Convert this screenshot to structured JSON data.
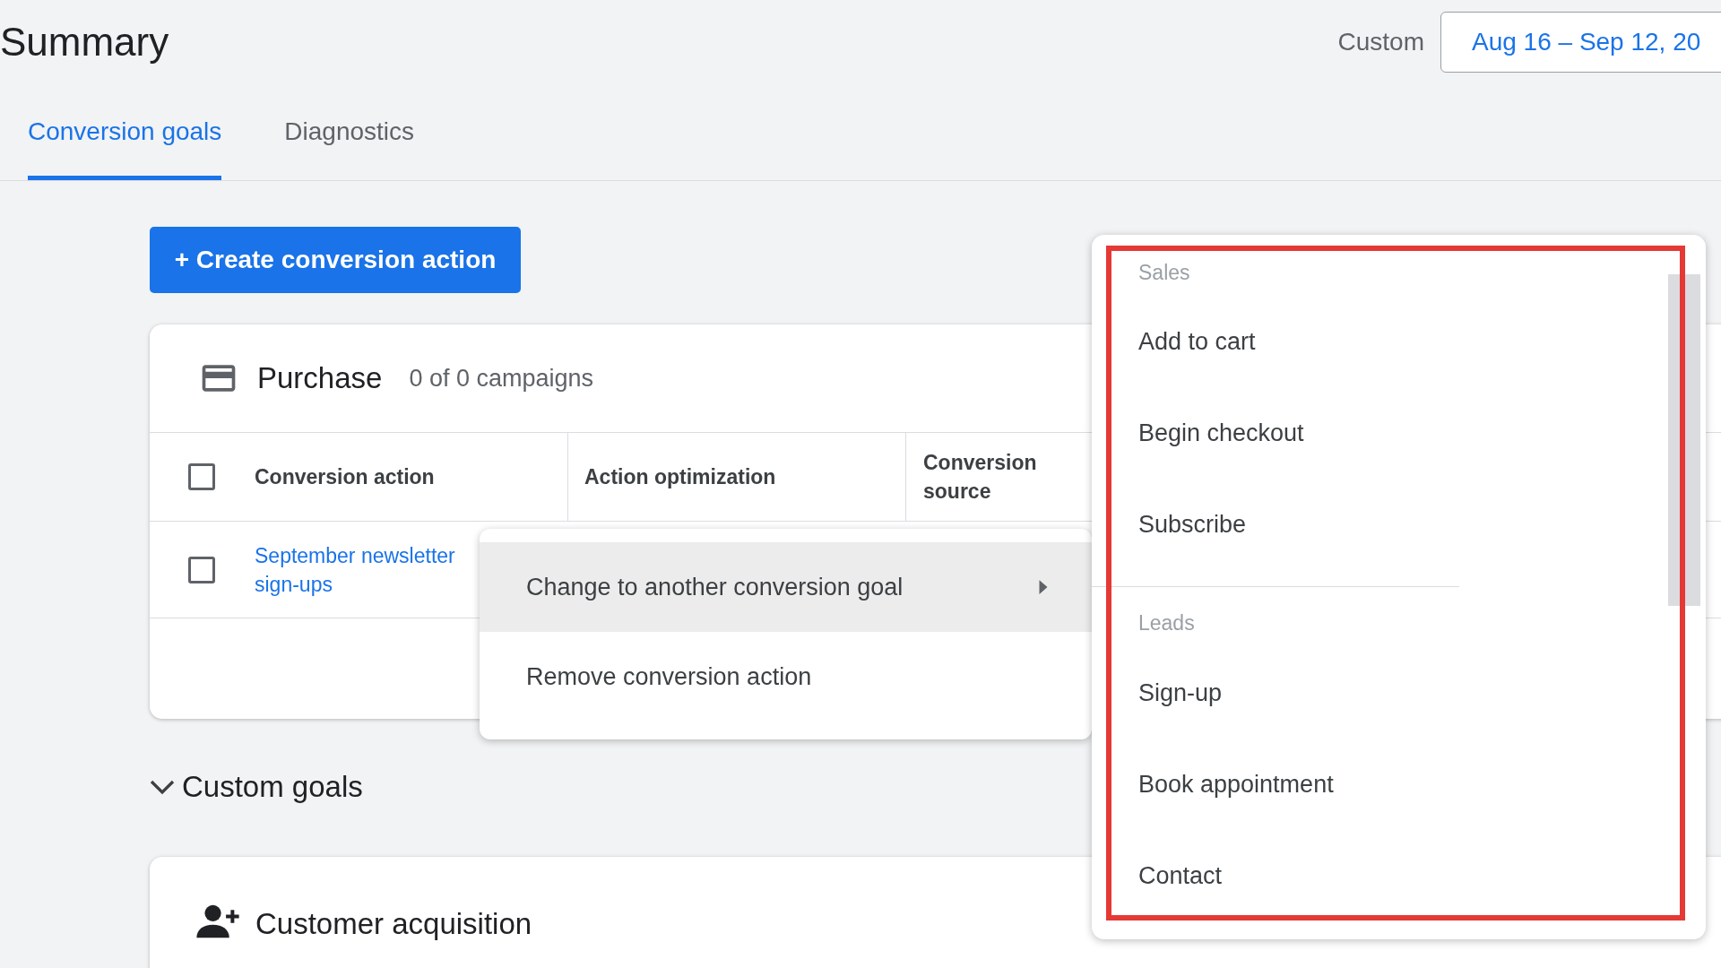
{
  "page_title": "Summary",
  "date_range": {
    "label": "Custom",
    "value": "Aug 16 – Sep 12, 20"
  },
  "tabs": [
    {
      "label": "Conversion goals",
      "selected": true
    },
    {
      "label": "Diagnostics",
      "selected": false
    }
  ],
  "create_button": "+ Create conversion action",
  "goal_card": {
    "title": "Purchase",
    "subtitle": "0 of 0 campaigns",
    "select_all_checked": false,
    "columns": [
      "Conversion action",
      "Action optimization",
      "Conversion source"
    ],
    "rows": [
      {
        "action": "September newsletter sign-ups",
        "checked": false
      }
    ]
  },
  "context_menu": {
    "items": [
      {
        "label": "Change to another conversion goal",
        "selected": true,
        "has_submenu": true
      },
      {
        "label": "Remove conversion action",
        "selected": false,
        "has_submenu": false
      }
    ]
  },
  "section": {
    "title": "Custom goals",
    "expanded": true
  },
  "custom_card": {
    "title": "Customer acquisition"
  },
  "submenu": {
    "groups": [
      {
        "heading": "Sales",
        "items": [
          "Add to cart",
          "Begin checkout",
          "Subscribe"
        ]
      },
      {
        "heading": "Leads",
        "items": [
          "Sign-up",
          "Book appointment",
          "Contact"
        ]
      }
    ]
  },
  "highlight_frame": true
}
